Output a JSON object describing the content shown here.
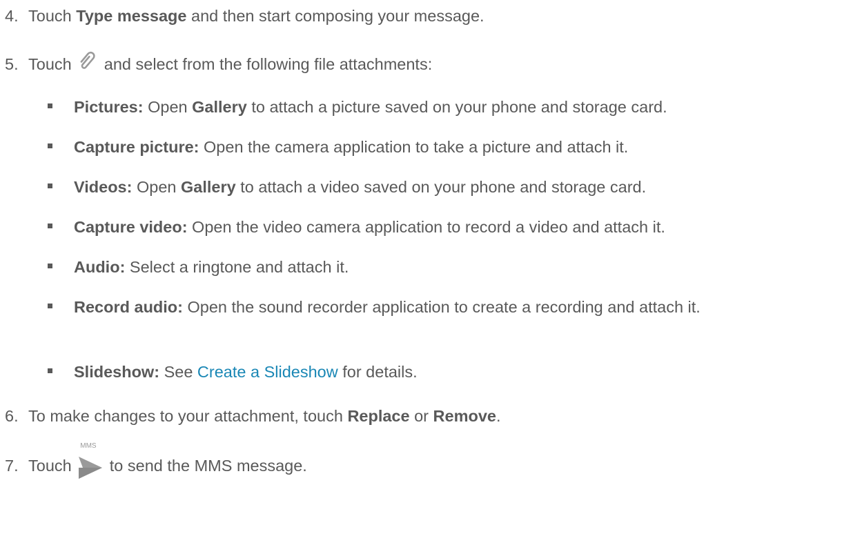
{
  "steps": {
    "s4": {
      "num": "4.",
      "pre": "Touch ",
      "bold": "Type message",
      "post": " and then start composing your message."
    },
    "s5": {
      "num": "5.",
      "pre": "Touch ",
      "icon": "paperclip-icon",
      "post": " and select from the following file attachments:"
    },
    "s6": {
      "num": "6.",
      "pre": "To make changes to your attachment, touch ",
      "bold1": "Replace",
      "mid": " or ",
      "bold2": "Remove",
      "post": "."
    },
    "s7": {
      "num": "7.",
      "pre": "Touch ",
      "icon": "send-mms-icon",
      "icon_label": "MMS",
      "post": " to send the MMS message."
    }
  },
  "attachments": [
    {
      "label": "Pictures:",
      "pre": " Open ",
      "bold": "Gallery",
      "post": " to attach a picture saved on your phone and storage card."
    },
    {
      "label": "Capture picture:",
      "text": " Open the camera application to take a picture and attach it."
    },
    {
      "label": "Videos:",
      "pre": " Open ",
      "bold": "Gallery",
      "post": " to attach a video saved on your phone and storage card."
    },
    {
      "label": "Capture video:",
      "text": " Open the video camera application to record a video and attach it."
    },
    {
      "label": "Audio:",
      "text": " Select a ringtone and attach it."
    },
    {
      "label": "Record audio:",
      "text": " Open the sound recorder application to create a recording and attach it."
    },
    {
      "label": "Slideshow:",
      "pre": " See ",
      "link": "Create a Slideshow",
      "post": " for details."
    }
  ],
  "colors": {
    "text": "#595959",
    "link": "#1a87b5",
    "icon": "#9a9a9a"
  }
}
